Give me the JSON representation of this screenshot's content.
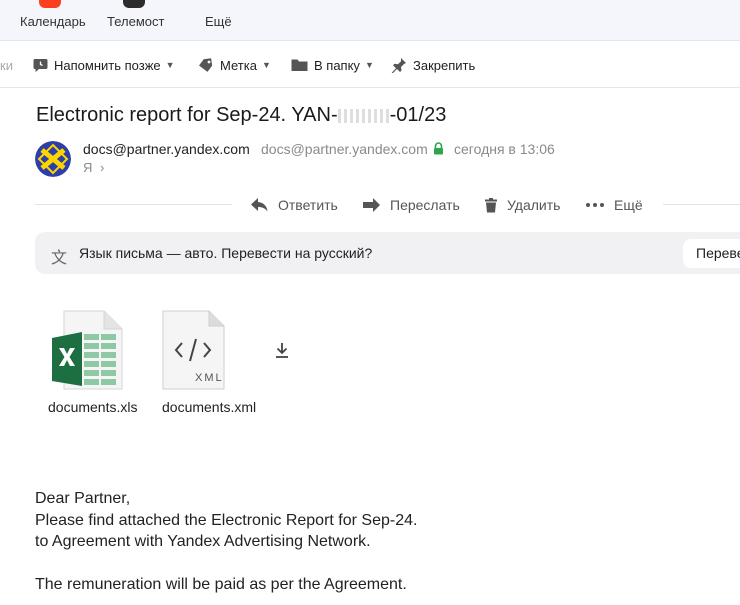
{
  "apps": [
    {
      "label": "Календарь"
    },
    {
      "label": "Телемост"
    },
    {
      "label": "Ещё"
    }
  ],
  "toolbar": {
    "left_label": "ки",
    "remind_label": "Напомнить позже",
    "label_label": "Метка",
    "folder_label": "В папку",
    "pin_label": "Закрепить"
  },
  "message": {
    "subject_prefix": "Electronic report for Sep-24. YAN-",
    "subject_suffix": "-01/23",
    "sender_name": "docs@partner.yandex.com",
    "sender_email": "docs@partner.yandex.com",
    "date": "сегодня в 13:06",
    "recipient": "Я"
  },
  "actions": {
    "reply": "Ответить",
    "forward": "Переслать",
    "delete": "Удалить",
    "more": "Ещё"
  },
  "translate": {
    "icon": "文",
    "text": "Язык письма — авто. Перевести на русский?",
    "button": "Перевести"
  },
  "attachments": [
    {
      "name": "documents.xls",
      "icon": "excel-file-icon"
    },
    {
      "name": "documents.xml",
      "icon": "xml-file-icon",
      "badge": "XML"
    }
  ],
  "body": {
    "line1": "Dear Partner,",
    "line2": "Please find attached the Electronic Report for Sep-24.",
    "line3": "to Agreement with Yandex Advertising Network.",
    "line4": "The remuneration will be paid as per the Agreement."
  },
  "colors": {
    "excel_green": "#1d6f42",
    "lock_green": "#2ea44f",
    "avatar_blue": "#2d3ea8",
    "avatar_yellow": "#ffd500"
  }
}
